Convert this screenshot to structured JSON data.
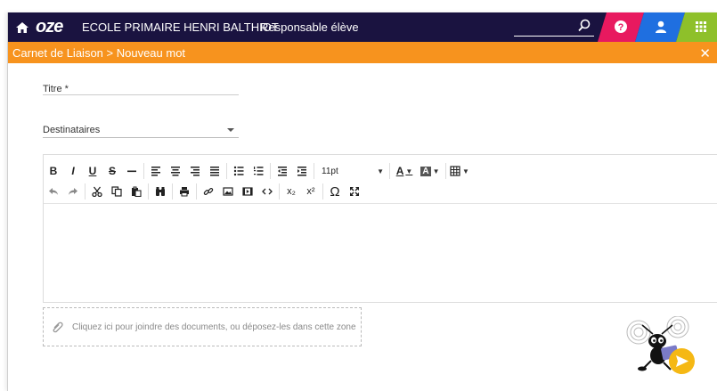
{
  "header": {
    "logo": "oze",
    "school_name": "ECOLE PRIMAIRE HENRI BALTHIOT",
    "role": "Responsable élève",
    "search_placeholder": ""
  },
  "breadcrumb": {
    "text": "Carnet de Liaison > Nouveau mot",
    "close": "✕"
  },
  "form": {
    "title_label": "Titre *",
    "recipients_label": "Destinataires"
  },
  "editor": {
    "font_size": "11pt",
    "bold": "B",
    "italic": "I",
    "underline": "U",
    "strike": "S",
    "text_color": "A",
    "bg_color": "A",
    "omega": "Ω",
    "subscript": "x₂",
    "superscript": "x²"
  },
  "attachment": {
    "text": "Cliquez ici pour joindre des documents, ou déposez-les dans cette zone"
  },
  "colors": {
    "topbar": "#1a1340",
    "orange": "#f7931e",
    "help_tab": "#e8195f",
    "user_tab": "#1f6fe0",
    "apps_tab": "#8ec02a",
    "send": "#f5b814"
  }
}
